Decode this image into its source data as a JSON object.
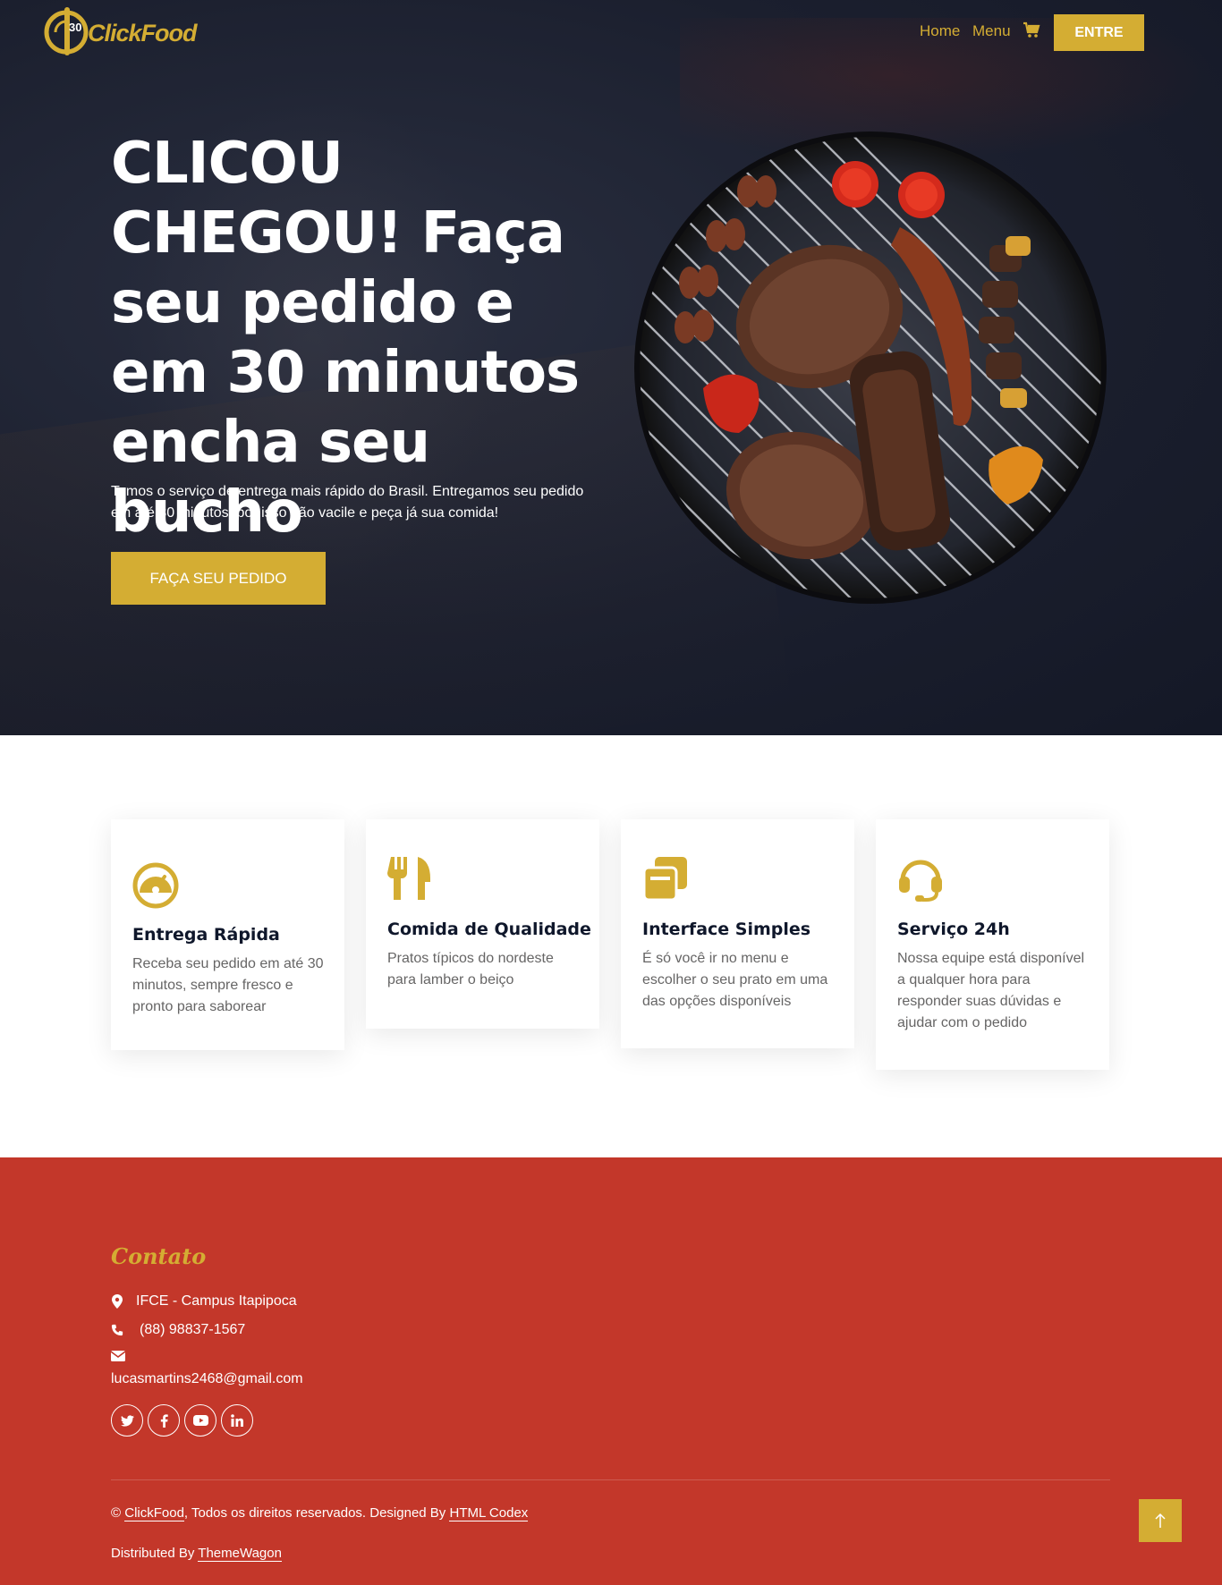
{
  "brand": {
    "name": "ClickFood",
    "logo_numbers": "30"
  },
  "nav": {
    "home": "Home",
    "menu": "Menu",
    "cart_icon": "cart-icon",
    "login": "ENTRE"
  },
  "hero": {
    "title": "CLICOU CHEGOU! Faça seu pedido e em 30 minutos encha seu bucho",
    "subtitle": "Temos o serviço de entrega mais rápido do Brasil. Entregamos seu pedido em até 30 minutos, por isso não vacile e peça já sua comida!",
    "cta": "FAÇA SEU PEDIDO"
  },
  "features": [
    {
      "icon": "speedometer-icon",
      "title": "Entrega Rápida",
      "text": "Receba seu pedido em até 30 minutos, sempre fresco e pronto para saborear"
    },
    {
      "icon": "utensils-icon",
      "title": "Comida de Qualidade",
      "text": "Pratos típicos do nordeste para lamber o beiço"
    },
    {
      "icon": "copy-icon",
      "title": "Interface Simples",
      "text": "É só você ir no menu e escolher o seu prato em uma das opções disponíveis"
    },
    {
      "icon": "headset-icon",
      "title": "Serviço 24h",
      "text": "Nossa equipe está disponível a qualquer hora para responder suas dúvidas e ajudar com o pedido"
    }
  ],
  "footer": {
    "contact_title": "Contato",
    "address": "IFCE - Campus Itapipoca",
    "phone": "(88) 98837-1567",
    "email": "lucasmartins2468@gmail.com",
    "socials": [
      "twitter-icon",
      "facebook-icon",
      "youtube-icon",
      "linkedin-icon"
    ],
    "copyright_prefix": "©",
    "copyright_brand": "ClickFood",
    "copyright_mid": ", Todos os direitos reservados. Designed By",
    "designer": "HTML Codex",
    "distributed_prefix": "Distributed By",
    "distributor": "ThemeWagon"
  },
  "colors": {
    "accent": "#d4ad33",
    "footer_bg": "#c3372a",
    "hero_bg": "#1b1f2e",
    "heading": "#0f172b"
  }
}
